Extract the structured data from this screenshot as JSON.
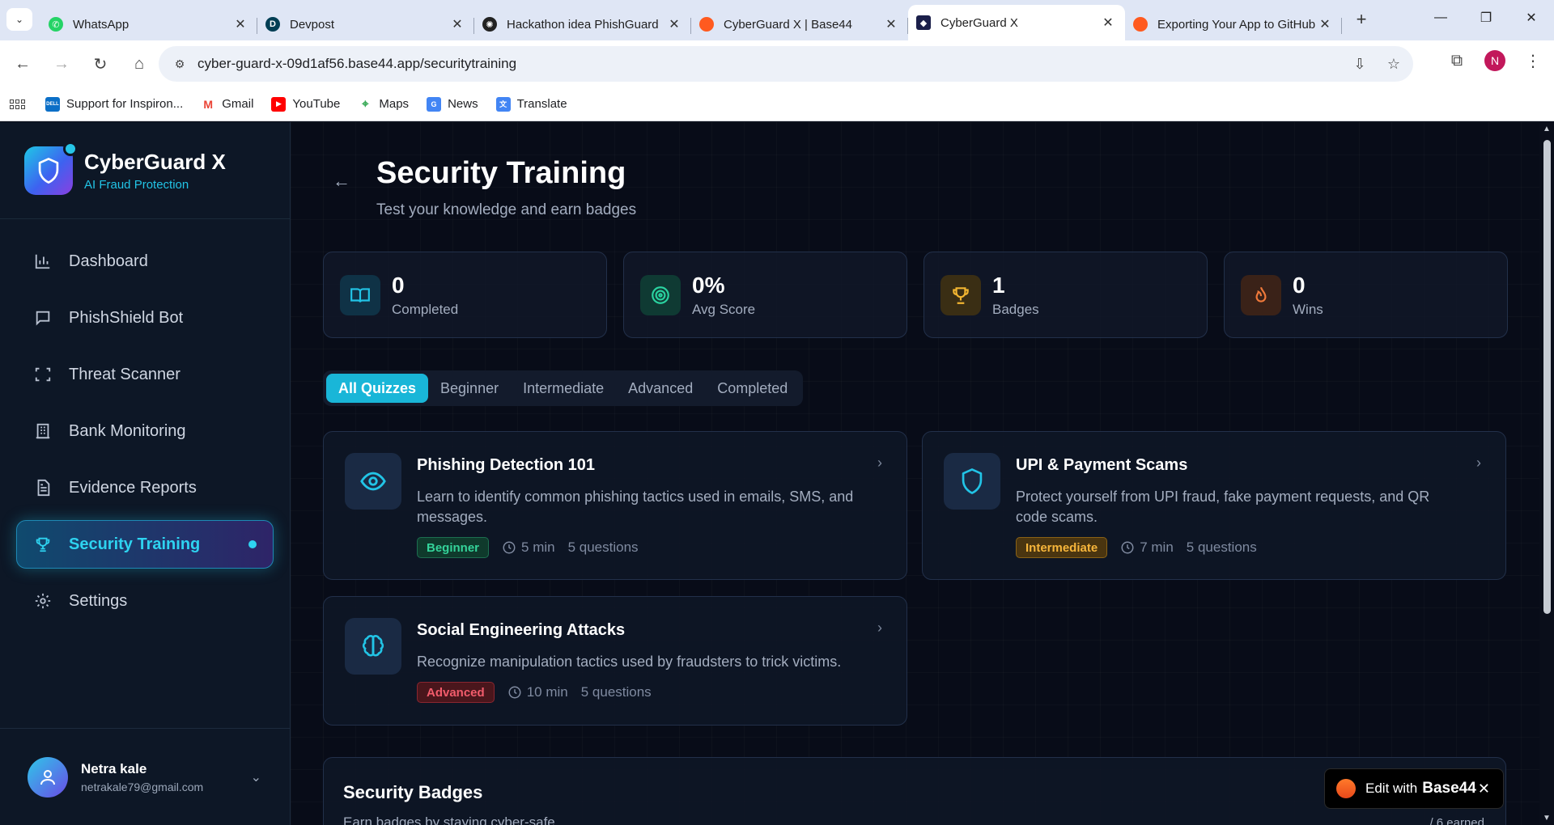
{
  "browser": {
    "tabs": [
      {
        "title": "WhatsApp",
        "icon": "whatsapp-icon",
        "color": "#25d366"
      },
      {
        "title": "Devpost",
        "icon": "devpost-icon",
        "color": "#003e54"
      },
      {
        "title": "Hackathon idea PhishGuard",
        "icon": "chatgpt-icon",
        "color": "#222222"
      },
      {
        "title": "CyberGuard X | Base44",
        "icon": "base44-icon",
        "color": "#ff5a1f"
      },
      {
        "title": "CyberGuard X",
        "icon": "cyberguard-icon",
        "color": "#1b1f4a"
      },
      {
        "title": "Exporting Your App to GitHub",
        "icon": "base44-icon",
        "color": "#ff5a1f"
      }
    ],
    "url": "cyber-guard-x-09d1af56.base44.app/securitytraining",
    "profile_initial": "N",
    "bookmarks": [
      {
        "label": "Support for Inspiron...",
        "color": "#0b6fc7",
        "badge": "DELL"
      },
      {
        "label": "Gmail",
        "color": "#ea4335",
        "badge": "M"
      },
      {
        "label": "YouTube",
        "color": "#ff0000",
        "badge": "▶"
      },
      {
        "label": "Maps",
        "color": "#34a853",
        "badge": "⌖"
      },
      {
        "label": "News",
        "color": "#4285f4",
        "badge": "G"
      },
      {
        "label": "Translate",
        "color": "#4285f4",
        "badge": "文"
      }
    ]
  },
  "brand": {
    "name": "CyberGuard X",
    "tagline": "AI Fraud Protection"
  },
  "nav": [
    {
      "label": "Dashboard",
      "icon": "bar-chart-icon"
    },
    {
      "label": "PhishShield Bot",
      "icon": "chat-icon"
    },
    {
      "label": "Threat Scanner",
      "icon": "scan-icon"
    },
    {
      "label": "Bank Monitoring",
      "icon": "bank-icon"
    },
    {
      "label": "Evidence Reports",
      "icon": "document-icon"
    },
    {
      "label": "Security Training",
      "icon": "trophy-icon",
      "active": true
    },
    {
      "label": "Settings",
      "icon": "gear-icon"
    }
  ],
  "user": {
    "name": "Netra kale",
    "email": "netrakale79@gmail.com"
  },
  "page": {
    "title": "Security Training",
    "subtitle": "Test your knowledge and earn badges"
  },
  "stats": [
    {
      "value": "0",
      "label": "Completed",
      "icon": "book-icon",
      "color": "#22c4e6",
      "bg": "#0f3246"
    },
    {
      "value": "0%",
      "label": "Avg Score",
      "icon": "target-icon",
      "color": "#2ad3a0",
      "bg": "#0f3a33"
    },
    {
      "value": "1",
      "label": "Badges",
      "icon": "trophy-icon",
      "color": "#f2b531",
      "bg": "#3a2e14"
    },
    {
      "value": "0",
      "label": "Wins",
      "icon": "flame-icon",
      "color": "#f0793a",
      "bg": "#3a2218"
    }
  ],
  "filters": [
    "All Quizzes",
    "Beginner",
    "Intermediate",
    "Advanced",
    "Completed"
  ],
  "quizzes": [
    {
      "title": "Phishing Detection 101",
      "description": "Learn to identify common phishing tactics used in emails, SMS, and messages.",
      "level": "Beginner",
      "duration": "5 min",
      "questions": "5 questions",
      "icon": "eye-icon"
    },
    {
      "title": "UPI & Payment Scams",
      "description": "Protect yourself from UPI fraud, fake payment requests, and QR code scams.",
      "level": "Intermediate",
      "duration": "7 min",
      "questions": "5 questions",
      "icon": "shield-icon"
    },
    {
      "title": "Social Engineering Attacks",
      "description": "Recognize manipulation tactics used by fraudsters to trick victims.",
      "level": "Advanced",
      "duration": "10 min",
      "questions": "5 questions",
      "icon": "brain-icon"
    }
  ],
  "badges": {
    "title": "Security Badges",
    "subtitle": "Earn badges by staying cyber-safe",
    "earned": "/ 6 earned"
  },
  "edit_widget": {
    "text": "Edit with",
    "brand": "Base44"
  }
}
